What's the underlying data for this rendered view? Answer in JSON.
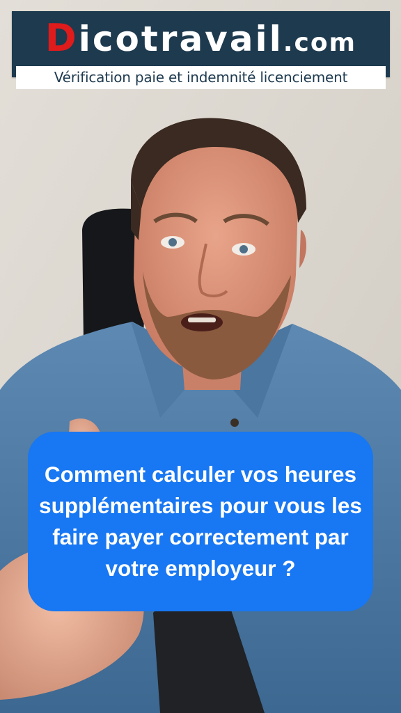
{
  "brand": {
    "logo_first_letter": "D",
    "logo_rest": "icotravail",
    "logo_domain": ".com",
    "tagline": "Vérification paie et indemnité licenciement",
    "colors": {
      "background": "#1e3a4f",
      "accent_letter": "#e01b1b",
      "text": "#ffffff"
    }
  },
  "question": {
    "text": "Comment calculer vos heures supplémentaires pour vous les faire payer correctement par votre employeur ?",
    "bubble_color": "#1877f2"
  }
}
